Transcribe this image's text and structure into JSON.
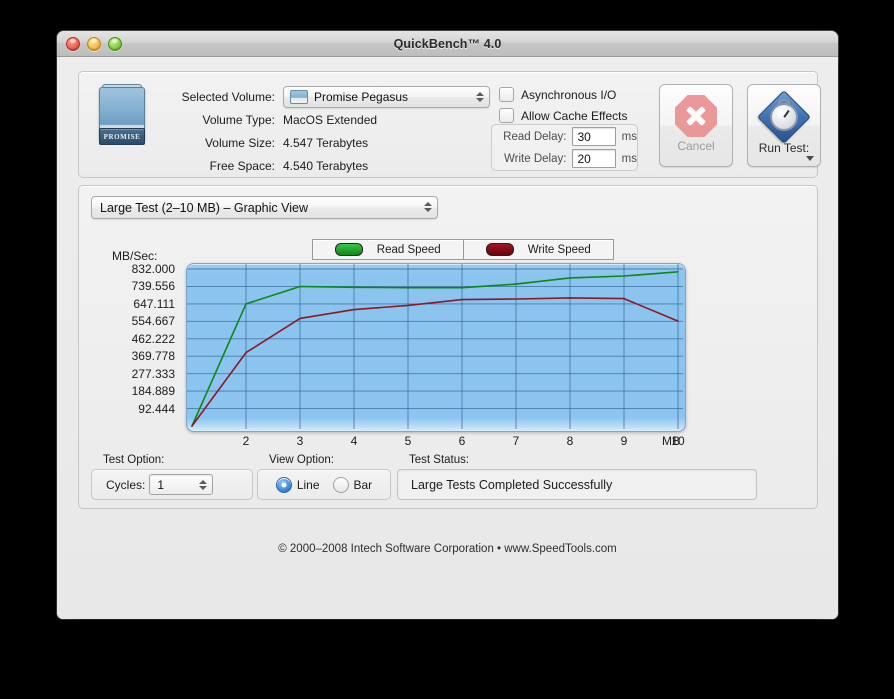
{
  "window": {
    "title": "QuickBench™ 4.0",
    "traffic_lights": [
      "close",
      "minimize",
      "zoom"
    ]
  },
  "volume_panel": {
    "drive_icon_label": "PROMISE",
    "rows": [
      {
        "label": "Selected Volume:",
        "value": "Promise Pegasus",
        "type": "popup"
      },
      {
        "label": "Volume Type:",
        "value": "MacOS Extended",
        "type": "text"
      },
      {
        "label": "Volume Size:",
        "value": "4.547 Terabytes",
        "type": "text"
      },
      {
        "label": "Free Space:",
        "value": "4.540 Terabytes",
        "type": "text"
      }
    ]
  },
  "options": {
    "checkboxes": [
      {
        "label": "Asynchronous I/O",
        "checked": false
      },
      {
        "label": "Allow Cache Effects",
        "checked": false
      }
    ],
    "delays": [
      {
        "label": "Read Delay:",
        "value": "30",
        "unit": "ms"
      },
      {
        "label": "Write Delay:",
        "value": "20",
        "unit": "ms"
      }
    ]
  },
  "actions": {
    "cancel_label": "Cancel",
    "run_label": "Run Test:"
  },
  "view_selector": {
    "value": "Large Test (2–10 MB) – Graphic View"
  },
  "chart_data": {
    "type": "line",
    "title": "",
    "xlabel": "MB",
    "ylabel": "MB/Sec:",
    "x": [
      1,
      2,
      3,
      4,
      5,
      6,
      7,
      8,
      9,
      10
    ],
    "xtick_labels": [
      "2",
      "3",
      "4",
      "5",
      "6",
      "7",
      "8",
      "9",
      "10"
    ],
    "xticks": [
      2,
      3,
      4,
      5,
      6,
      7,
      8,
      9,
      10
    ],
    "ytick_labels": [
      "832.000",
      "739.556",
      "647.111",
      "554.667",
      "462.222",
      "369.778",
      "277.333",
      "184.889",
      "92.444"
    ],
    "yticks": [
      832.0,
      739.556,
      647.111,
      554.667,
      462.222,
      369.778,
      277.333,
      184.889,
      92.444
    ],
    "ylim": [
      0,
      832.0
    ],
    "xlim": [
      1,
      10
    ],
    "grid": true,
    "legend_position": "top",
    "series": [
      {
        "name": "Read Speed",
        "color": "#0a8a14",
        "values": [
          0,
          647,
          739,
          735,
          733,
          733,
          752,
          785,
          795,
          817
        ]
      },
      {
        "name": "Write Speed",
        "color": "#8d1823",
        "values": [
          0,
          389,
          570,
          617,
          639,
          670,
          673,
          679,
          675,
          556
        ]
      }
    ]
  },
  "legend": {
    "entries": [
      {
        "label": "Read Speed",
        "color": "#0a8a14"
      },
      {
        "label": "Write Speed",
        "color": "#8d1823"
      }
    ]
  },
  "bottom": {
    "test_option_label": "Test Option:",
    "cycles_label": "Cycles:",
    "cycles_value": "1",
    "view_option_label": "View Option:",
    "view_options": [
      {
        "label": "Line",
        "selected": true
      },
      {
        "label": "Bar",
        "selected": false
      }
    ],
    "test_status_label": "Test Status:",
    "test_status_value": "Large Tests Completed Successfully"
  },
  "footer": {
    "copyright": "© 2000–2008 Intech Software Corporation • www.SpeedTools.com"
  }
}
